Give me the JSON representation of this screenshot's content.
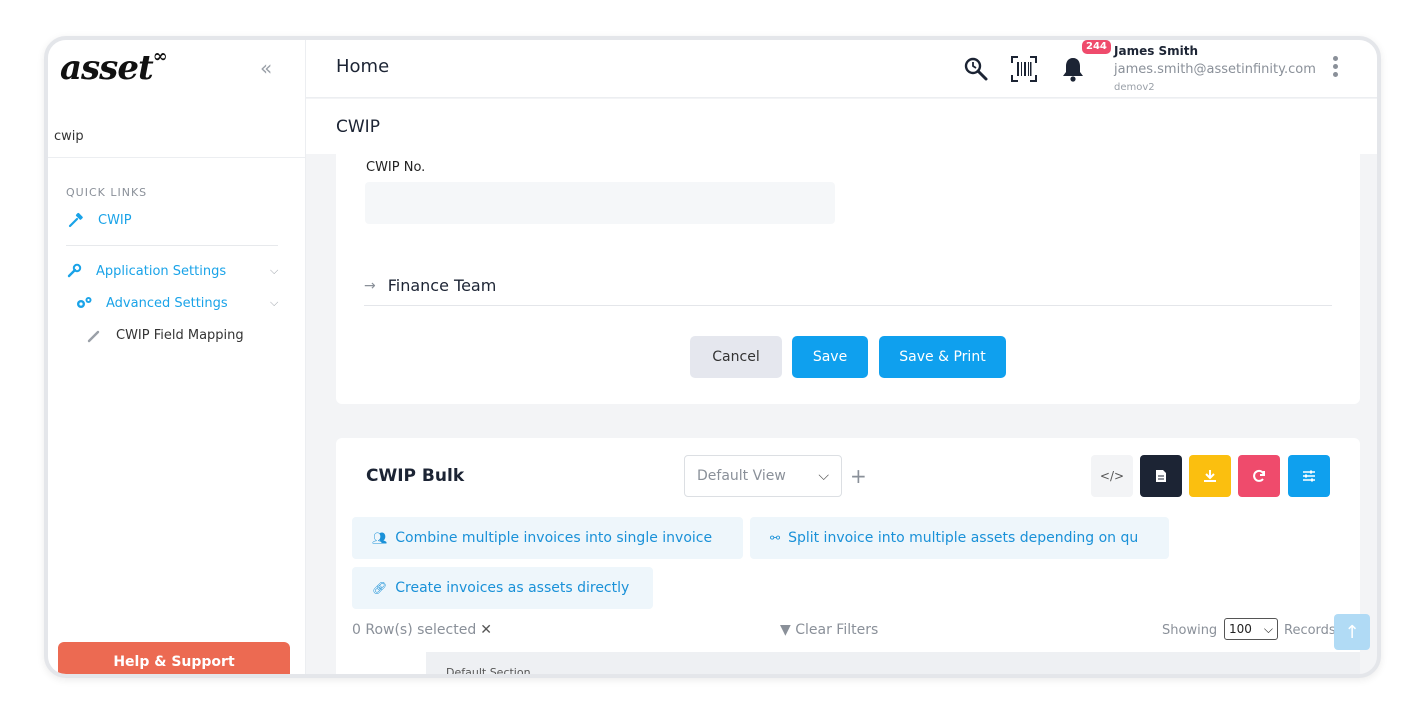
{
  "sidebar": {
    "logo_text": "asset",
    "logo_mark": "∞",
    "collapse_icon": "double-chevron-left-icon",
    "search_value": "cwip",
    "quick_links_title": "QUICK LINKS",
    "items": [
      {
        "label": "CWIP",
        "icon": "hammer-icon"
      },
      {
        "label": "Application Settings",
        "icon": "wrench-icon"
      },
      {
        "label": "Advanced Settings",
        "icon": "gears-icon"
      },
      {
        "label": "CWIP Field Mapping",
        "icon": "brush-icon"
      }
    ],
    "help_label": "Help & Support"
  },
  "topbar": {
    "title": "Home",
    "notification_count": "244",
    "user_name": "James Smith",
    "user_email": "james.smith@assetinfinity.com",
    "user_org": "demov2"
  },
  "subbar": {
    "title": "CWIP"
  },
  "form": {
    "cwip_no_label": "CWIP No.",
    "cwip_no_value": "",
    "finance_team_label": "Finance Team",
    "cancel_label": "Cancel",
    "save_label": "Save",
    "save_print_label": "Save & Print"
  },
  "bulk": {
    "title": "CWIP Bulk",
    "view_selected": "Default View",
    "chips": [
      "Combine multiple invoices into single invoice",
      "Split invoice into multiple assets depending on qu",
      "Create invoices as assets directly"
    ],
    "rows_selected": "0 Row(s) selected",
    "clear_filters": "Clear Filters",
    "showing_label": "Showing",
    "records_value": "100",
    "records_label": "Records",
    "section_label": "Default Section"
  },
  "colors": {
    "accent": "#0fa0ee",
    "help": "#ec6a52",
    "badge": "#ef4b6c",
    "download": "#fbbf0f",
    "dark": "#1c2434"
  }
}
